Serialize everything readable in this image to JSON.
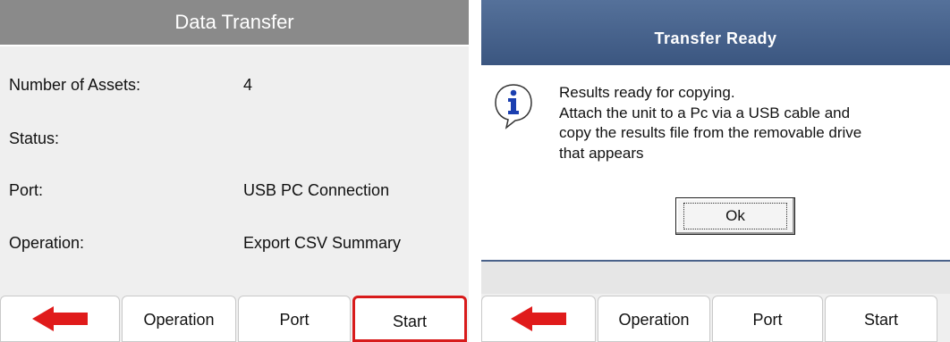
{
  "left": {
    "title": "Data Transfer",
    "fields": [
      {
        "label": "Number of Assets:",
        "value": "4"
      },
      {
        "label": "Status:",
        "value": ""
      },
      {
        "label": "Port:",
        "value": "USB PC Connection"
      },
      {
        "label": "Operation:",
        "value": "Export CSV Summary"
      }
    ],
    "buttons": {
      "back_icon": "back-arrow-icon",
      "operation": "Operation",
      "port": "Port",
      "start": "Start"
    }
  },
  "dialog": {
    "title": "Transfer Ready",
    "icon": "info-icon",
    "lines": [
      "Results ready for copying.",
      "Attach the unit to a Pc via a USB cable and",
      "copy the results file from the removable drive",
      "that appears"
    ],
    "ok_label": "Ok"
  },
  "right_footer": {
    "back_icon": "back-arrow-icon",
    "operation": "Operation",
    "port": "Port",
    "start": "Start"
  },
  "colors": {
    "title_gray": "#8a8a8a",
    "dialog_title_blue": "#3b5680",
    "arrow_red": "#e01b1b",
    "highlight_red": "#d81b1b"
  }
}
